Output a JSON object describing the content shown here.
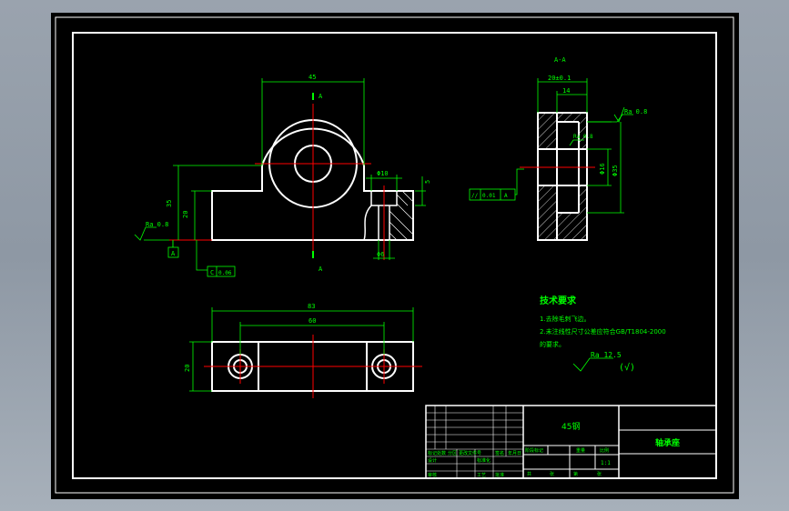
{
  "colors": {
    "background_outer": "#9aa3ae",
    "canvas": "#000000",
    "border": "#ffffff",
    "dimension": "#00ff00",
    "centerline": "#ff0000",
    "title_text": "#00ff00"
  },
  "section_label": "A-A",
  "dimensions": {
    "front_width": "45",
    "total_height": "35",
    "base_height": "20",
    "hole_dia": "Φ10",
    "hole_dia_small": "Φ6",
    "slot_depth": "5",
    "side_width": "20±0.1",
    "side_inner": "14",
    "side_height": "Φ16",
    "side_bore": "Φ35",
    "top_length": "83",
    "hole_spacing": "60",
    "top_width": "20"
  },
  "roughness": {
    "front": "Ra 0.8",
    "side_top": "Ra 0.8",
    "side_bore": "Ra 0.8",
    "general": "Ra 12.5",
    "general_suffix": "(√)"
  },
  "tolerance": {
    "flatness_symbol": "⏥",
    "parallel_symbol": "//",
    "parallel_value": "0.01",
    "parallel_datum": "A",
    "perp_symbol": "⊥",
    "perp_value": "0.01",
    "perp_datum": "A",
    "datum_letter": "A",
    "c_symbol": "C",
    "c_value": "0.06"
  },
  "section_marks": [
    "A",
    "A"
  ],
  "tech_requirements": {
    "heading": "技术要求",
    "items": [
      "1.去除毛刺飞边。",
      "2.未注线性尺寸公差应符合GB/T1804-2000",
      "的要求。"
    ]
  },
  "title_block": {
    "material": "45钢",
    "part_name": "轴承座",
    "scale": "1:1",
    "labels": [
      "标记",
      "处数",
      "分区",
      "更改文件号",
      "签名",
      "年月日",
      "设计",
      "标准化",
      "审核",
      "工艺",
      "批准",
      "阶段标记",
      "重量",
      "比例",
      "共",
      "张",
      "第",
      "张"
    ]
  }
}
